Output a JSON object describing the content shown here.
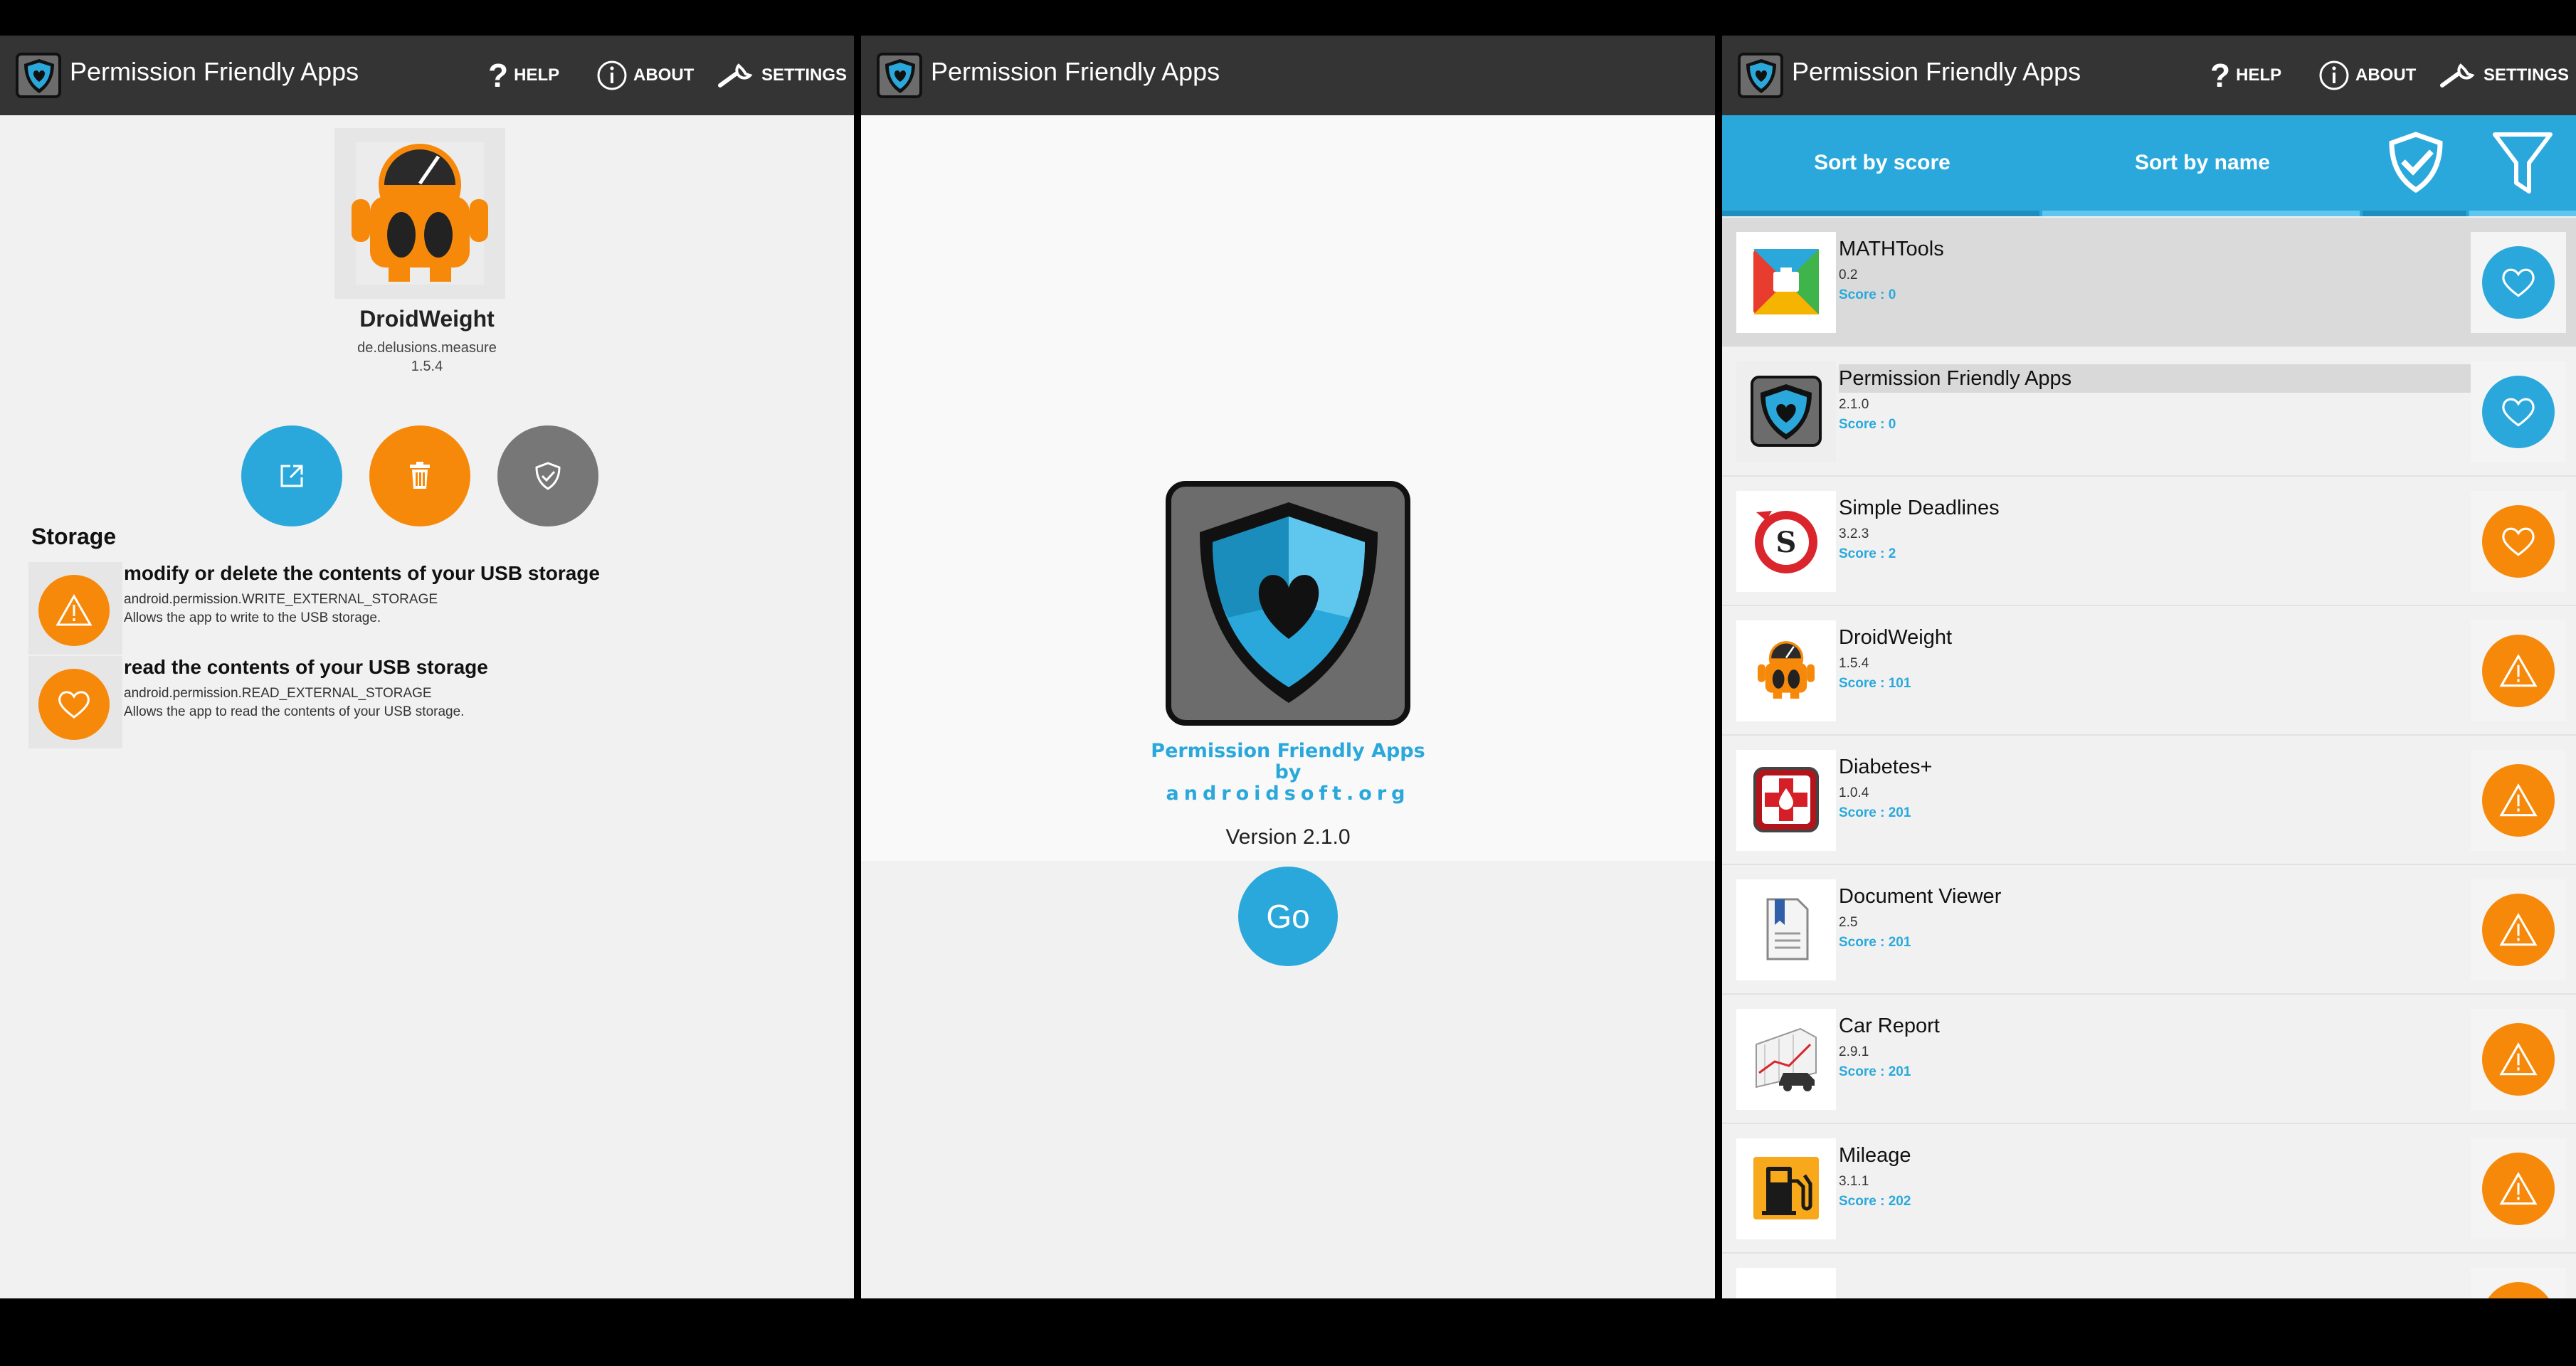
{
  "colors": {
    "accent": "#2aa8dc",
    "warning": "#f7890a",
    "actionbar": "#343434",
    "grey_button": "#777777"
  },
  "app_title": "Permission Friendly Apps",
  "actions": {
    "help": "HELP",
    "help_icon": "?",
    "about": "ABOUT",
    "settings": "SETTINGS"
  },
  "detail": {
    "name": "DroidWeight",
    "package": "de.delusions.measure",
    "version": "1.5.4",
    "buttons": [
      {
        "icon": "open-external-icon",
        "color": "#2aa8dc"
      },
      {
        "icon": "trash-icon",
        "color": "#f7890a"
      },
      {
        "icon": "shield-check-icon",
        "color": "#777777"
      }
    ],
    "section": "Storage",
    "permissions": [
      {
        "icon": "warning-icon",
        "title": "modify or delete the contents of your USB storage",
        "name": "android.permission.WRITE_EXTERNAL_STORAGE",
        "desc": "Allows the app to write to the USB storage."
      },
      {
        "icon": "heart-icon",
        "title": "read the contents of your USB storage",
        "name": "android.permission.READ_EXTERNAL_STORAGE",
        "desc": "Allows the app to read the contents of your USB storage."
      }
    ]
  },
  "splash": {
    "line1": "Permission Friendly Apps",
    "line2": "by",
    "line3": "androidsoft.org",
    "version": "Version 2.1.0",
    "go": "Go"
  },
  "list": {
    "tabs": {
      "by_score": "Sort by score",
      "by_name": "Sort by name"
    },
    "icons": [
      "shield-check-icon",
      "filter-icon"
    ],
    "apps": [
      {
        "name": "MATHTools",
        "version": "0.2",
        "score": "Score : 0",
        "badge": "heart-icon",
        "badge_color": "blue",
        "icon": "mathtools-icon"
      },
      {
        "name": "Permission Friendly Apps",
        "version": "2.1.0",
        "score": "Score : 0",
        "badge": "heart-icon",
        "badge_color": "blue",
        "icon": "shield-heart-icon"
      },
      {
        "name": "Simple Deadlines",
        "version": "3.2.3",
        "score": "Score : 2",
        "badge": "heart-icon",
        "badge_color": "orange",
        "icon": "deadlines-icon"
      },
      {
        "name": "DroidWeight",
        "version": "1.5.4",
        "score": "Score : 101",
        "badge": "warning-icon",
        "badge_color": "orange",
        "icon": "droidweight-icon"
      },
      {
        "name": "Diabetes+",
        "version": "1.0.4",
        "score": "Score : 201",
        "badge": "warning-icon",
        "badge_color": "orange",
        "icon": "diabetes-icon"
      },
      {
        "name": "Document Viewer",
        "version": "2.5",
        "score": "Score : 201",
        "badge": "warning-icon",
        "badge_color": "orange",
        "icon": "document-icon"
      },
      {
        "name": "Car Report",
        "version": "2.9.1",
        "score": "Score : 201",
        "badge": "warning-icon",
        "badge_color": "orange",
        "icon": "car-report-icon"
      },
      {
        "name": "Mileage",
        "version": "3.1.1",
        "score": "Score : 202",
        "badge": "warning-icon",
        "badge_color": "orange",
        "icon": "fuel-pump-icon"
      }
    ]
  }
}
